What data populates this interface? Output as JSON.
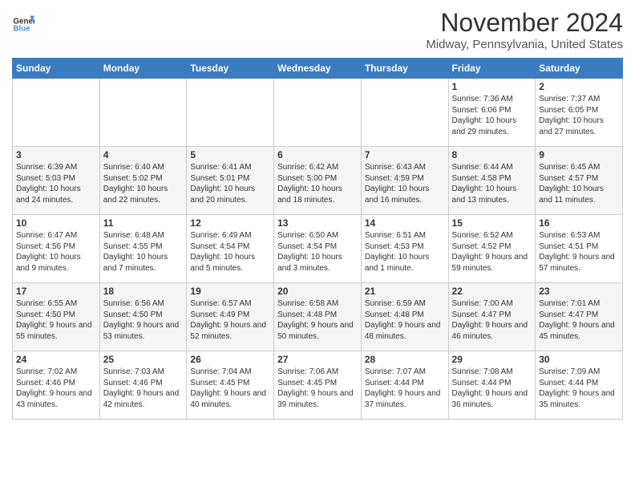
{
  "header": {
    "logo_line1": "General",
    "logo_line2": "Blue",
    "title": "November 2024",
    "subtitle": "Midway, Pennsylvania, United States"
  },
  "days_of_week": [
    "Sunday",
    "Monday",
    "Tuesday",
    "Wednesday",
    "Thursday",
    "Friday",
    "Saturday"
  ],
  "weeks": [
    [
      {
        "day": "",
        "info": ""
      },
      {
        "day": "",
        "info": ""
      },
      {
        "day": "",
        "info": ""
      },
      {
        "day": "",
        "info": ""
      },
      {
        "day": "",
        "info": ""
      },
      {
        "day": "1",
        "info": "Sunrise: 7:36 AM\nSunset: 6:06 PM\nDaylight: 10 hours and 29 minutes."
      },
      {
        "day": "2",
        "info": "Sunrise: 7:37 AM\nSunset: 6:05 PM\nDaylight: 10 hours and 27 minutes."
      }
    ],
    [
      {
        "day": "3",
        "info": "Sunrise: 6:39 AM\nSunset: 5:03 PM\nDaylight: 10 hours and 24 minutes."
      },
      {
        "day": "4",
        "info": "Sunrise: 6:40 AM\nSunset: 5:02 PM\nDaylight: 10 hours and 22 minutes."
      },
      {
        "day": "5",
        "info": "Sunrise: 6:41 AM\nSunset: 5:01 PM\nDaylight: 10 hours and 20 minutes."
      },
      {
        "day": "6",
        "info": "Sunrise: 6:42 AM\nSunset: 5:00 PM\nDaylight: 10 hours and 18 minutes."
      },
      {
        "day": "7",
        "info": "Sunrise: 6:43 AM\nSunset: 4:59 PM\nDaylight: 10 hours and 16 minutes."
      },
      {
        "day": "8",
        "info": "Sunrise: 6:44 AM\nSunset: 4:58 PM\nDaylight: 10 hours and 13 minutes."
      },
      {
        "day": "9",
        "info": "Sunrise: 6:45 AM\nSunset: 4:57 PM\nDaylight: 10 hours and 11 minutes."
      }
    ],
    [
      {
        "day": "10",
        "info": "Sunrise: 6:47 AM\nSunset: 4:56 PM\nDaylight: 10 hours and 9 minutes."
      },
      {
        "day": "11",
        "info": "Sunrise: 6:48 AM\nSunset: 4:55 PM\nDaylight: 10 hours and 7 minutes."
      },
      {
        "day": "12",
        "info": "Sunrise: 6:49 AM\nSunset: 4:54 PM\nDaylight: 10 hours and 5 minutes."
      },
      {
        "day": "13",
        "info": "Sunrise: 6:50 AM\nSunset: 4:54 PM\nDaylight: 10 hours and 3 minutes."
      },
      {
        "day": "14",
        "info": "Sunrise: 6:51 AM\nSunset: 4:53 PM\nDaylight: 10 hours and 1 minute."
      },
      {
        "day": "15",
        "info": "Sunrise: 6:52 AM\nSunset: 4:52 PM\nDaylight: 9 hours and 59 minutes."
      },
      {
        "day": "16",
        "info": "Sunrise: 6:53 AM\nSunset: 4:51 PM\nDaylight: 9 hours and 57 minutes."
      }
    ],
    [
      {
        "day": "17",
        "info": "Sunrise: 6:55 AM\nSunset: 4:50 PM\nDaylight: 9 hours and 55 minutes."
      },
      {
        "day": "18",
        "info": "Sunrise: 6:56 AM\nSunset: 4:50 PM\nDaylight: 9 hours and 53 minutes."
      },
      {
        "day": "19",
        "info": "Sunrise: 6:57 AM\nSunset: 4:49 PM\nDaylight: 9 hours and 52 minutes."
      },
      {
        "day": "20",
        "info": "Sunrise: 6:58 AM\nSunset: 4:48 PM\nDaylight: 9 hours and 50 minutes."
      },
      {
        "day": "21",
        "info": "Sunrise: 6:59 AM\nSunset: 4:48 PM\nDaylight: 9 hours and 48 minutes."
      },
      {
        "day": "22",
        "info": "Sunrise: 7:00 AM\nSunset: 4:47 PM\nDaylight: 9 hours and 46 minutes."
      },
      {
        "day": "23",
        "info": "Sunrise: 7:01 AM\nSunset: 4:47 PM\nDaylight: 9 hours and 45 minutes."
      }
    ],
    [
      {
        "day": "24",
        "info": "Sunrise: 7:02 AM\nSunset: 4:46 PM\nDaylight: 9 hours and 43 minutes."
      },
      {
        "day": "25",
        "info": "Sunrise: 7:03 AM\nSunset: 4:46 PM\nDaylight: 9 hours and 42 minutes."
      },
      {
        "day": "26",
        "info": "Sunrise: 7:04 AM\nSunset: 4:45 PM\nDaylight: 9 hours and 40 minutes."
      },
      {
        "day": "27",
        "info": "Sunrise: 7:06 AM\nSunset: 4:45 PM\nDaylight: 9 hours and 39 minutes."
      },
      {
        "day": "28",
        "info": "Sunrise: 7:07 AM\nSunset: 4:44 PM\nDaylight: 9 hours and 37 minutes."
      },
      {
        "day": "29",
        "info": "Sunrise: 7:08 AM\nSunset: 4:44 PM\nDaylight: 9 hours and 36 minutes."
      },
      {
        "day": "30",
        "info": "Sunrise: 7:09 AM\nSunset: 4:44 PM\nDaylight: 9 hours and 35 minutes."
      }
    ]
  ]
}
